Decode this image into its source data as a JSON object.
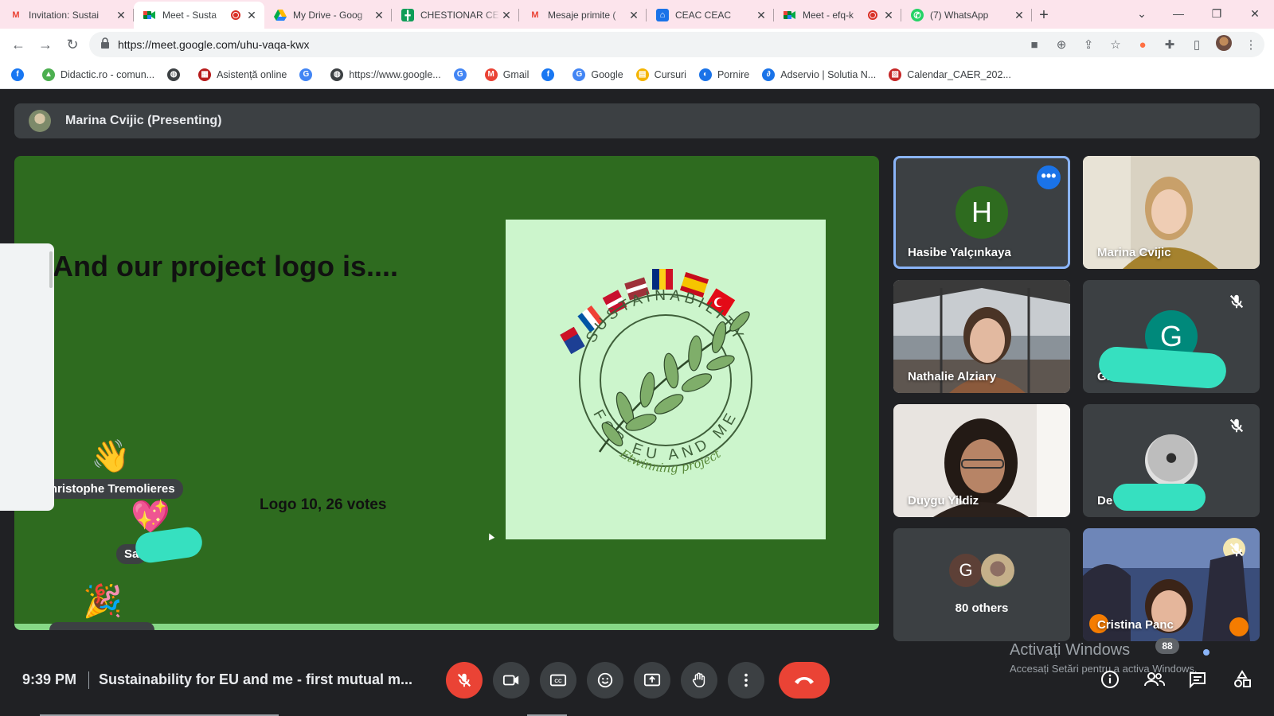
{
  "tabs": [
    {
      "title": "Invitation: Sustai",
      "icon": "gmail-icon",
      "active": false,
      "recording": false
    },
    {
      "title": "Meet - Susta",
      "icon": "meet-icon",
      "active": true,
      "recording": true
    },
    {
      "title": "My Drive - Goog",
      "icon": "drive-icon",
      "active": false,
      "recording": false
    },
    {
      "title": "CHESTIONAR CE",
      "icon": "sheets-icon",
      "active": false,
      "recording": false
    },
    {
      "title": "Mesaje primite (",
      "icon": "gmail-icon",
      "active": false,
      "recording": false
    },
    {
      "title": "CEAC CEAC",
      "icon": "classroom-icon",
      "active": false,
      "recording": false
    },
    {
      "title": "Meet - efq-k",
      "icon": "meet-icon",
      "active": false,
      "recording": true
    },
    {
      "title": "(7) WhatsApp",
      "icon": "whatsapp-icon",
      "active": false,
      "recording": false
    }
  ],
  "url": "https://meet.google.com/uhu-vaqa-kwx",
  "bookmarks": [
    {
      "label": "",
      "icon": "facebook-icon",
      "color": "#1877f2"
    },
    {
      "label": "Didactic.ro - comun...",
      "icon": "didactic-icon",
      "color": "#4caf50"
    },
    {
      "label": "",
      "icon": "globe-icon",
      "color": "#3c4043"
    },
    {
      "label": "Asistență online",
      "icon": "asistenta-icon",
      "color": "#b71c1c"
    },
    {
      "label": "",
      "icon": "google-icon",
      "color": "#4285f4"
    },
    {
      "label": "https://www.google...",
      "icon": "globe-icon",
      "color": "#3c4043"
    },
    {
      "label": "",
      "icon": "google-icon",
      "color": "#4285f4"
    },
    {
      "label": "Gmail",
      "icon": "gmail-icon",
      "color": "#ea4335"
    },
    {
      "label": "",
      "icon": "facebook-icon",
      "color": "#1877f2"
    },
    {
      "label": "Google",
      "icon": "google-icon",
      "color": "#4285f4"
    },
    {
      "label": "Cursuri",
      "icon": "classroom-icon",
      "color": "#f4b400"
    },
    {
      "label": "Pornire",
      "icon": "pornire-icon",
      "color": "#1a73e8"
    },
    {
      "label": "Adservio | Solutia N...",
      "icon": "adservio-icon",
      "color": "#1a73e8"
    },
    {
      "label": "Calendar_CAER_202...",
      "icon": "pdf-icon",
      "color": "#c62828"
    }
  ],
  "presenter": {
    "label": "Marina Cvijic (Presenting)"
  },
  "slide": {
    "title": "And our project logo is....",
    "caption": "Logo 10, 26 votes",
    "logo_top_text": "SUSTAINABILITY",
    "logo_bottom_text": "FOR EU AND ME",
    "logo_sub_text": "Etwinning project"
  },
  "reactions": [
    {
      "emoji": "👋",
      "name": "Christophe Tremolieres"
    },
    {
      "emoji": "💖",
      "name": "Sa"
    },
    {
      "emoji": "🎉",
      "name": ""
    }
  ],
  "participants": [
    {
      "name": "Hasibe Yalçınkaya",
      "kind": "avatar",
      "initial": "H",
      "avatar_color": "#2e6b1f",
      "selected": true,
      "muted": false
    },
    {
      "name": "Marina Cvijic",
      "kind": "video",
      "muted": false
    },
    {
      "name": "Nathalie Alziary",
      "kind": "video",
      "muted": false
    },
    {
      "name": "Gia",
      "kind": "avatar",
      "initial": "G",
      "avatar_color": "#00897b",
      "muted": true
    },
    {
      "name": "Duygu Yildiz",
      "kind": "video",
      "muted": false
    },
    {
      "name": "De",
      "kind": "photo-avatar",
      "muted": true
    },
    {
      "name": "80 others",
      "kind": "group",
      "initial": "G",
      "avatar_color": "#5d4037"
    },
    {
      "name": "Cristina Panc",
      "kind": "video",
      "muted": true
    }
  ],
  "footer": {
    "time": "9:39 PM",
    "meeting_title": "Sustainability for EU and me - first mutual m...",
    "people_count": "88"
  },
  "watermark": {
    "line1": "Activați Windows",
    "line2": "Accesați Setări pentru a activa Windows."
  },
  "colors": {
    "end_call": "#ea4335",
    "mic_off": "#ea4335",
    "slide_bg": "#2e6b1f",
    "logo_bg": "#ccf5cc",
    "selection": "#8ab4f8"
  }
}
